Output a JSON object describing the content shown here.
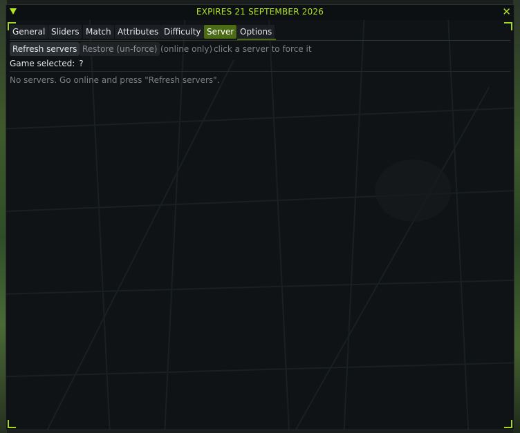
{
  "window": {
    "title": "EXPIRES 21 SEPTEMBER 2026",
    "accent_color": "#b4e61e",
    "collapse_icon": "triangle-down-icon",
    "close_icon": "close-icon"
  },
  "tabs": [
    {
      "label": "General",
      "active": false
    },
    {
      "label": "Sliders",
      "active": false
    },
    {
      "label": "Match",
      "active": false
    },
    {
      "label": "Attributes",
      "active": false
    },
    {
      "label": "Difficulty",
      "active": false
    },
    {
      "label": "Server",
      "active": true
    },
    {
      "label": "Options",
      "active": false
    }
  ],
  "server": {
    "refresh_label": "Refresh servers",
    "restore_label": "Restore (un-force)",
    "online_hint": "(online only)",
    "click_hint": "click a server to force it",
    "game_selected_label": "Game selected:",
    "game_selected_value": "?",
    "empty_message": "No servers. Go online and press \"Refresh servers\"."
  }
}
